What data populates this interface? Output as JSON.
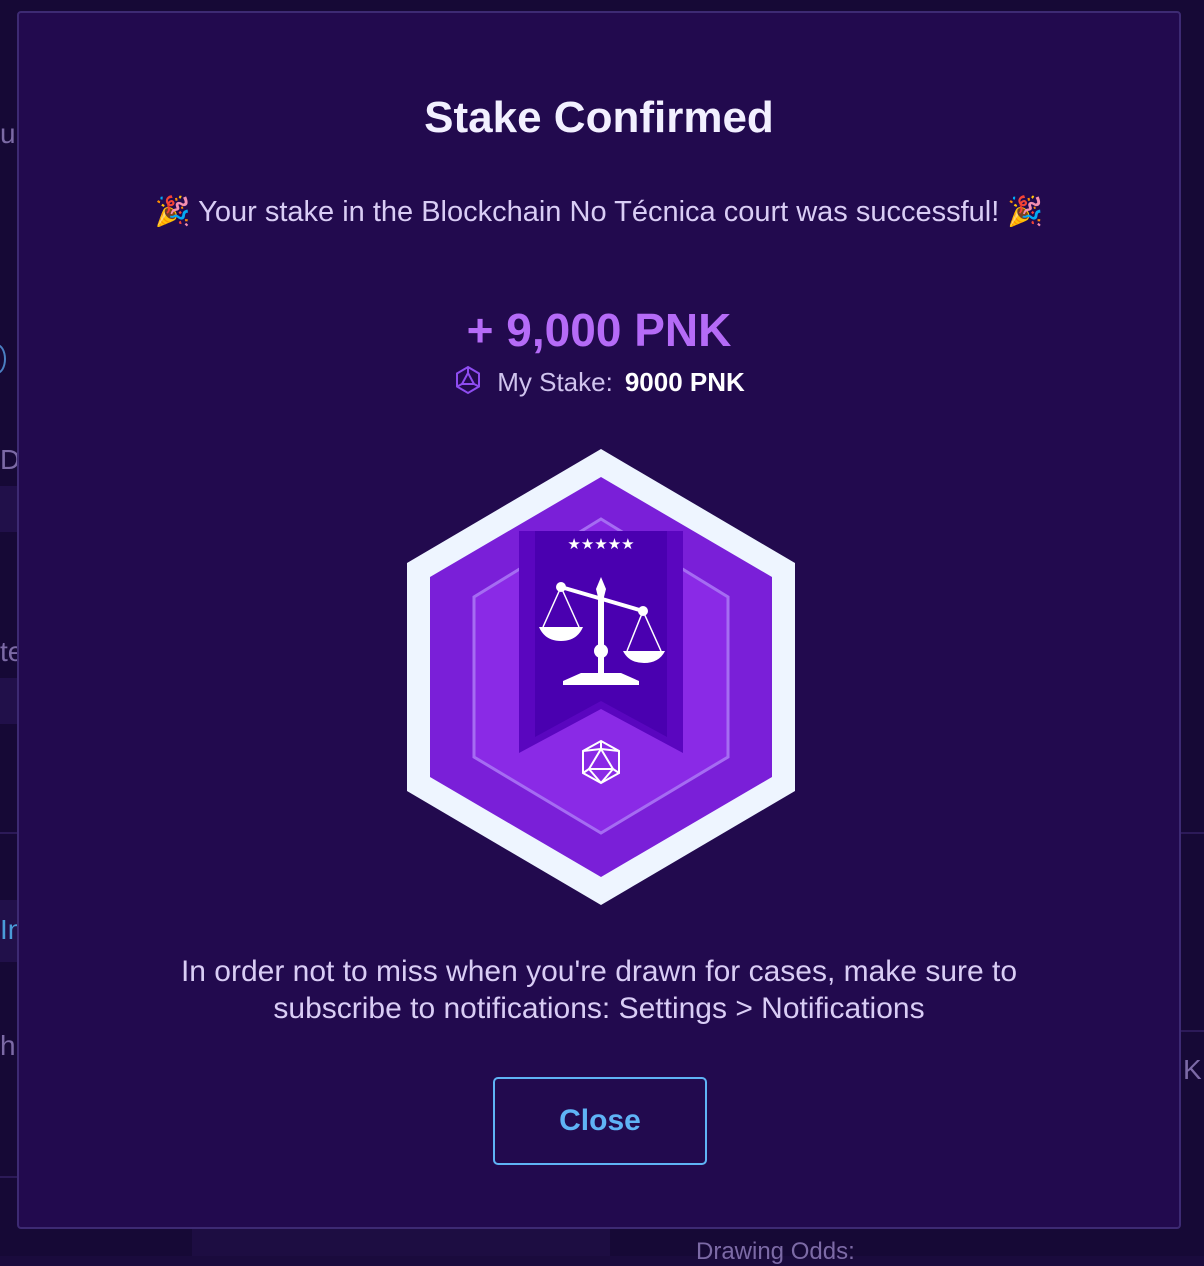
{
  "modal": {
    "title": "Stake Confirmed",
    "subtitle": "🎉 Your stake in the Blockchain No Técnica court was successful! 🎉",
    "amount": "+ 9,000 PNK",
    "stake_label": "My Stake:",
    "stake_value": "9000 PNK",
    "badge_stars": "★★★★★",
    "notice_line1": "In order not to miss when you're drawn for cases, make sure to",
    "notice_line2": "subscribe to notifications: Settings > Notifications",
    "close_label": "Close"
  },
  "background": {
    "fragments": [
      "u",
      "D",
      "te",
      "In",
      "h",
      "K"
    ],
    "bottom_text": "Drawing Odds:"
  },
  "colors": {
    "modal_bg": "#220a4e",
    "accent_purple": "#b56bf7",
    "button_blue": "#5fb3f5",
    "badge_outer": "#f0f6ff",
    "badge_fill": "#7b1fd9"
  },
  "icons": {
    "pnk": "pnk-token-icon",
    "scale": "scale-of-justice-icon",
    "d20": "icosahedron-icon"
  }
}
